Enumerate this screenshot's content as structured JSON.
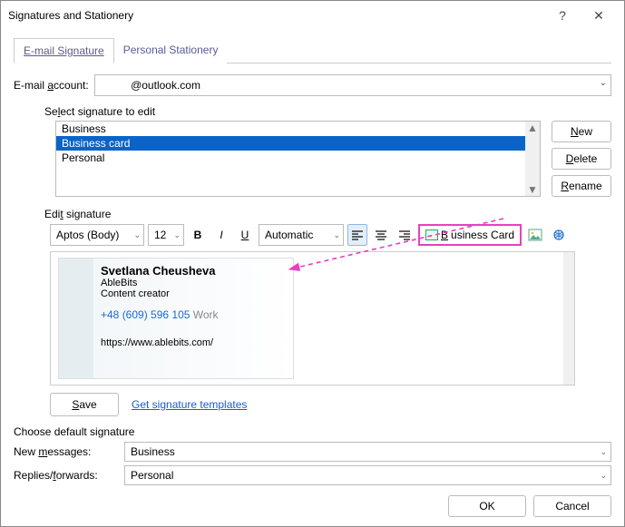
{
  "window": {
    "title": "Signatures and Stationery",
    "help": "?",
    "close": "✕"
  },
  "tabs": {
    "email_sig": "E-mail Signature",
    "personal": "Personal Stationery"
  },
  "account": {
    "label_pre": "E-mail ",
    "label_u": "a",
    "label_post": "ccount:",
    "value": "          @outlook.com"
  },
  "list": {
    "label_pre": "Se",
    "label_u": "l",
    "label_post": "ect signature to edit",
    "items": [
      "Business",
      "Business card",
      "Personal"
    ],
    "selected_index": 1
  },
  "buttons": {
    "new_u": "N",
    "new_post": "ew",
    "delete_u": "D",
    "delete_post": "elete",
    "rename_u": "R",
    "rename_post": "ename"
  },
  "edit": {
    "label_pre": "Edi",
    "label_u": "t",
    "label_post": " signature",
    "font": "Aptos (Body)",
    "size": "12",
    "bold": "B",
    "italic": "I",
    "underline": "U",
    "color": "Automatic",
    "biz_u": "B",
    "biz_post": "usiness Card"
  },
  "card": {
    "name": "Svetlana Cheusheva",
    "company": "AbleBits",
    "role": "Content creator",
    "phone": "+48 (609) 596 105",
    "phone_tag": " Work",
    "url": "https://www.ablebits.com/"
  },
  "save": {
    "btn_u": "S",
    "btn_post": "ave",
    "link": "Get signature templates"
  },
  "defaults": {
    "section": "Choose default signature",
    "new_pre": "New ",
    "new_u": "m",
    "new_post": "essages:",
    "new_val": "Business",
    "rep_pre": "Replies/",
    "rep_u": "f",
    "rep_post": "orwards:",
    "rep_val": "Personal"
  },
  "footer": {
    "ok": "OK",
    "cancel": "Cancel"
  }
}
